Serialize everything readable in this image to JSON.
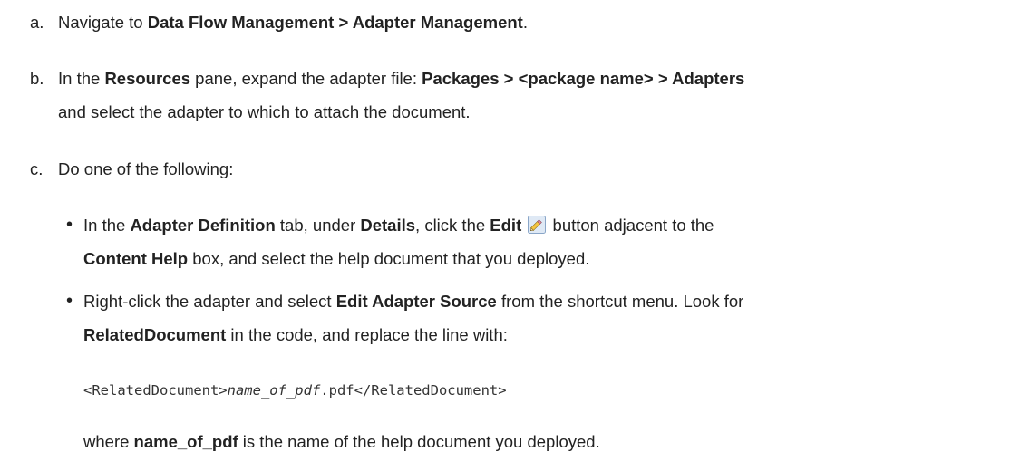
{
  "steps": {
    "a": {
      "marker": "a.",
      "t1": "Navigate to ",
      "b1": "Data Flow Management > Adapter Management",
      "t2": "."
    },
    "b": {
      "marker": "b.",
      "t1": "In the ",
      "b1": "Resources",
      "t2": " pane, expand the adapter file: ",
      "b2": "Packages > <package name> > Adapters",
      "line2": "and select the adapter to which to attach the document."
    },
    "c": {
      "marker": "c.",
      "t1": "Do one of the following:"
    }
  },
  "bullets": [
    {
      "dot": "•",
      "l1_t1": "In the ",
      "l1_b1": "Adapter Definition",
      "l1_t2": " tab, under ",
      "l1_b2": "Details",
      "l1_t3": ", click the ",
      "l1_b3": "Edit",
      "l1_t4": " button adjacent to the",
      "l2_b1": "Content Help",
      "l2_t1": " box, and select the help document that you deployed."
    },
    {
      "dot": "•",
      "l1_t1": "Right-click the adapter and select ",
      "l1_b1": "Edit Adapter Source",
      "l1_t2": " from the shortcut menu. Look for",
      "l2_b1": "RelatedDocument",
      "l2_t1": " in the code, and replace the line with:",
      "code_pre": "<RelatedDocument>",
      "code_italic": "name_of_pdf",
      "code_post": ".pdf</RelatedDocument>",
      "where_t1": "where ",
      "where_b1": "name_of_pdf",
      "where_t2": " is the name of the help document you deployed."
    }
  ],
  "icons": {
    "edit": "pencil-edit-icon"
  }
}
